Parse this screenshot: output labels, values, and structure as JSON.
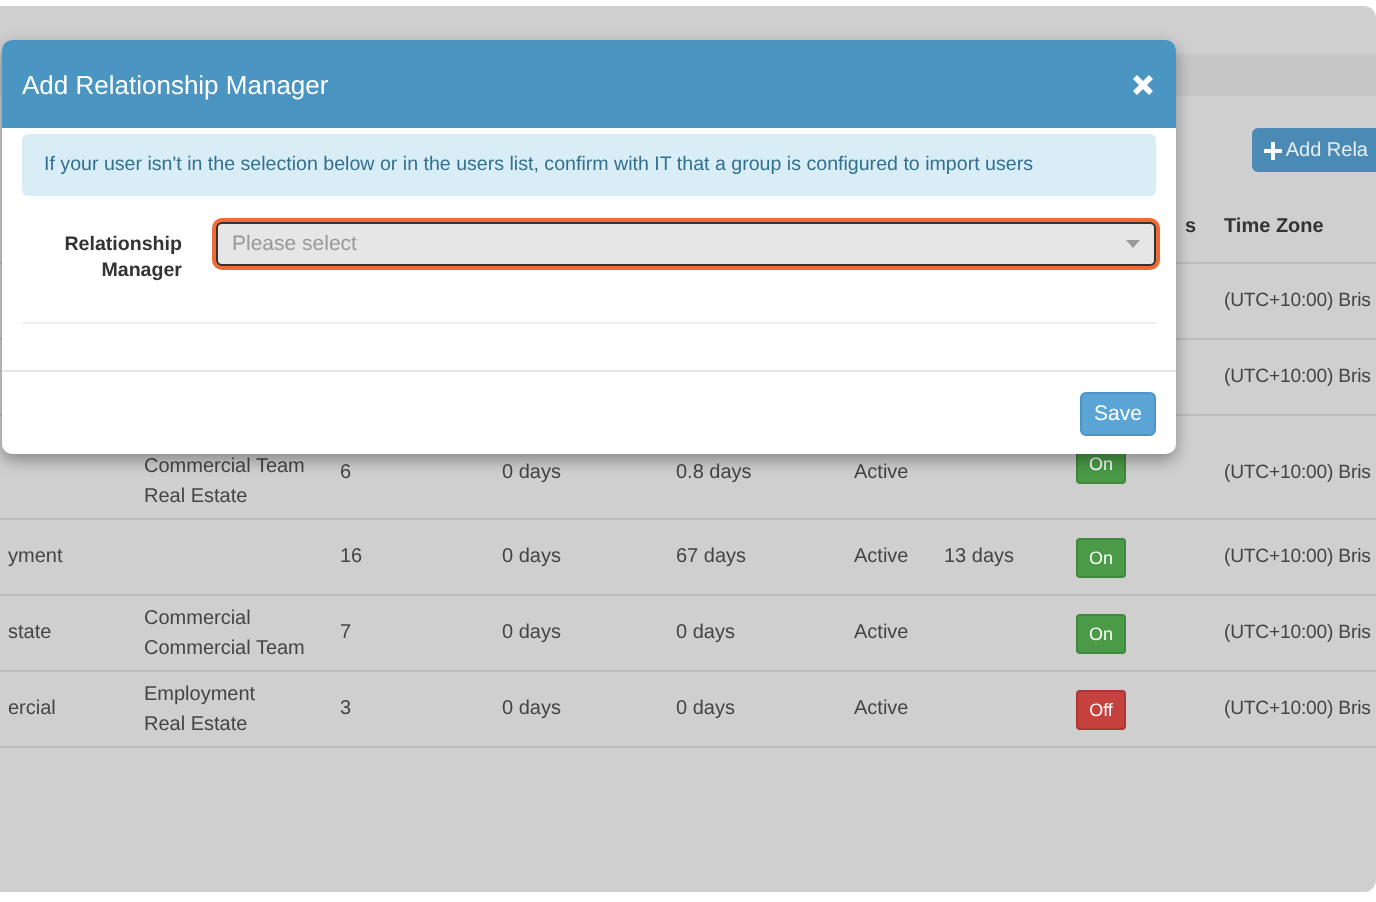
{
  "page": {
    "add_button": "Add Rela",
    "columns": [
      "s",
      "Time Zone"
    ],
    "rows": [
      {
        "time_zone": "(UTC+10:00) Bris"
      },
      {
        "time_zone": "(UTC+10:00) Bris"
      },
      {
        "column_2": [
          "Commercial Team",
          "Real Estate"
        ],
        "column_3": "6",
        "column_4": "0 days",
        "column_5": "0.8 days",
        "column_6": "Active",
        "toggle": {
          "label": "On",
          "on": true
        },
        "time_zone": "(UTC+10:00) Bris"
      },
      {
        "column_1": "yment",
        "column_3": "16",
        "column_4": "0 days",
        "column_5": "67 days",
        "column_6": "Active",
        "column_7": "13 days",
        "toggle": {
          "label": "On",
          "on": true
        },
        "time_zone": "(UTC+10:00) Bris"
      },
      {
        "column_1": "state",
        "column_2": [
          "Commercial",
          "Commercial Team"
        ],
        "column_3": "7",
        "column_4": "0 days",
        "column_5": "0 days",
        "column_6": "Active",
        "toggle": {
          "label": "On",
          "on": true
        },
        "time_zone": "(UTC+10:00) Bris"
      },
      {
        "column_1": "ercial",
        "column_2": [
          "Employment",
          "Real Estate"
        ],
        "column_3": "3",
        "column_4": "0 days",
        "column_5": "0 days",
        "column_6": "Active",
        "toggle": {
          "label": "Off",
          "on": false
        },
        "time_zone": "(UTC+10:00) Bris"
      }
    ]
  },
  "dialog": {
    "title": "Add Relationship Manager",
    "alert": "If your user isn't in the selection below or in the users list, confirm with IT that a group is configured to import users",
    "field": {
      "label": "Relationship Manager",
      "placeholder": "Please select",
      "focused": true
    },
    "buttons": [
      "Save"
    ]
  }
}
